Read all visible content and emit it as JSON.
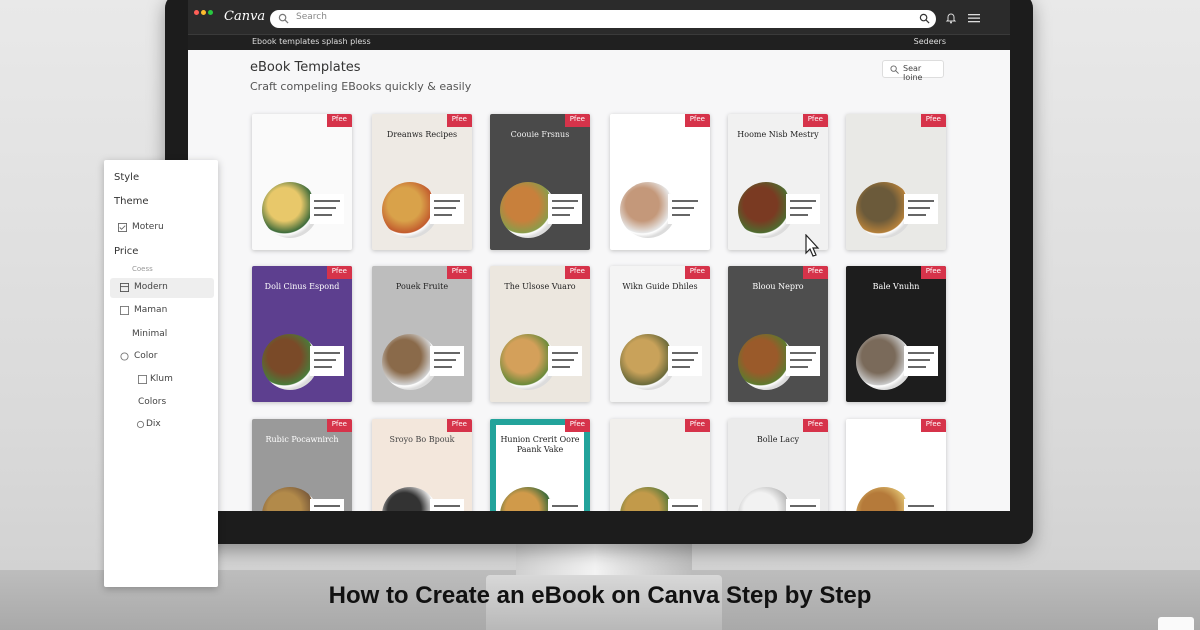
{
  "app": {
    "logo": "Canva"
  },
  "search": {
    "placeholder": "Search"
  },
  "subbar": {
    "breadcrumb": "Ebook templates splash pless",
    "bookmark": "Sedeers"
  },
  "page": {
    "title": "eBook Templates",
    "subtitle": "Craft compeling EBooks quickly & easily",
    "sort_label": "Sear Ioine"
  },
  "filters": {
    "style": "Style",
    "theme": "Theme",
    "theme_option": "Moteru",
    "price": "Price",
    "price_sub": "Coess",
    "modern": "Modern",
    "maman": "Maman",
    "minimal": "Minimal",
    "color": "Color",
    "klum": "Klum",
    "colors": "Colors",
    "dix": "Dix"
  },
  "tag_label": "Pfee",
  "templates": [
    {
      "title": ""
    },
    {
      "title": "Dreanws Recipes"
    },
    {
      "title": "Coouie Frsnus"
    },
    {
      "title": ""
    },
    {
      "title": "Hoome Nisb Mestry"
    },
    {
      "title": ""
    },
    {
      "title": "Doli Cinus Espond"
    },
    {
      "title": "Pouek Fruite"
    },
    {
      "title": "The Ulsose Vuaro"
    },
    {
      "title": "Wikn Guide Dhiles"
    },
    {
      "title": "Bloou Nepro"
    },
    {
      "title": "Bale Vnuhn"
    },
    {
      "title": "Rubic Pocawnirch"
    },
    {
      "title": "Sroyo Bo Bpouk"
    },
    {
      "title": "Hunion Crerit Oore Paank Vake"
    },
    {
      "title": ""
    },
    {
      "title": "Bolle Lacy"
    },
    {
      "title": ""
    }
  ],
  "caption": "How to Create an eBook on Canva Step by Step",
  "colors": {
    "tag": "#d6334a",
    "topbar": "#2b2b2b",
    "bezel": "#1c1c1c",
    "screen": "#f7f7f8"
  }
}
